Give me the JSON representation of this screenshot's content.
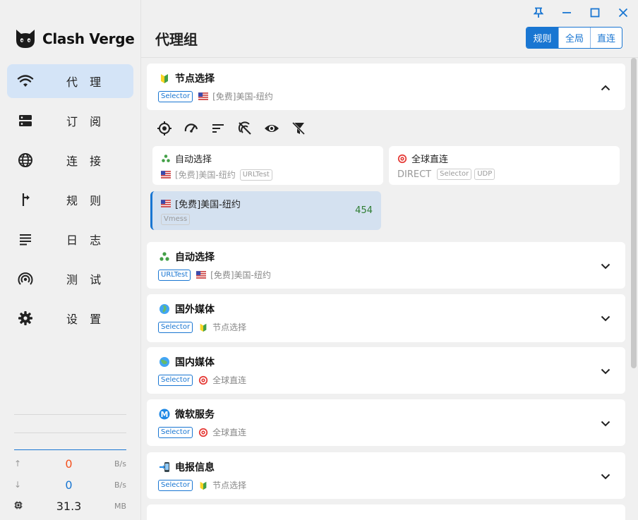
{
  "app": {
    "name": "Clash Verge"
  },
  "nav": [
    {
      "label": "代 理",
      "icon": "wifi-icon",
      "active": true
    },
    {
      "label": "订 阅",
      "icon": "dns-icon",
      "active": false
    },
    {
      "label": "连 接",
      "icon": "globe-icon",
      "active": false
    },
    {
      "label": "规 则",
      "icon": "fork-icon",
      "active": false
    },
    {
      "label": "日 志",
      "icon": "notes-icon",
      "active": false
    },
    {
      "label": "测 试",
      "icon": "radar-icon",
      "active": false
    },
    {
      "label": "设 置",
      "icon": "gear-icon",
      "active": false
    }
  ],
  "traffic": {
    "up": {
      "value": "0",
      "unit": "B/s",
      "color": "#f4511e"
    },
    "down": {
      "value": "0",
      "unit": "B/s",
      "color": "#1976d2"
    },
    "mem": {
      "value": "31.3",
      "unit": "MB"
    }
  },
  "header": {
    "title": "代理组",
    "modes": [
      {
        "label": "规则",
        "active": true
      },
      {
        "label": "全局",
        "active": false
      },
      {
        "label": "直连",
        "active": false
      }
    ]
  },
  "groups": [
    {
      "name": "节点选择",
      "tag": "Selector",
      "now": "[免费]美国-纽约",
      "icon": "beginner-icon",
      "now_icon": "us-flag-icon",
      "expanded": true
    },
    {
      "name": "自动选择",
      "tag": "URLTest",
      "now": "[免费]美国-纽约",
      "icon": "recycle-icon",
      "now_icon": "us-flag-icon",
      "expanded": false
    },
    {
      "name": "国外媒体",
      "tag": "Selector",
      "now": "节点选择",
      "icon": "globe-africa-icon",
      "now_icon": "beginner-icon",
      "expanded": false
    },
    {
      "name": "国内媒体",
      "tag": "Selector",
      "now": "全球直连",
      "icon": "globe-asia-icon",
      "now_icon": "target-icon",
      "expanded": false
    },
    {
      "name": "微软服务",
      "tag": "Selector",
      "now": "全球直连",
      "icon": "metro-m-icon",
      "now_icon": "target-icon",
      "expanded": false
    },
    {
      "name": "电报信息",
      "tag": "Selector",
      "now": "节点选择",
      "icon": "phone-arrow-icon",
      "now_icon": "beginner-icon",
      "expanded": false
    }
  ],
  "toolbar": [
    "locate-icon",
    "speed-icon",
    "sort-icon",
    "filter-delay-off-icon",
    "eye-icon",
    "filter-off-icon"
  ],
  "proxies": [
    {
      "name": "自动选择",
      "sub": "[免费]美国-纽约",
      "tags": [
        "URLTest"
      ],
      "icon": "recycle-icon",
      "sub_icon": "us-flag-icon",
      "delay": "",
      "selected": false
    },
    {
      "name": "全球直连",
      "sub": "DIRECT",
      "tags": [
        "Selector",
        "UDP"
      ],
      "icon": "target-icon",
      "sub_icon": "",
      "delay": "",
      "selected": false
    },
    {
      "name": "[免费]美国-纽约",
      "sub": "",
      "tags": [
        "Vmess"
      ],
      "icon": "us-flag-icon",
      "sub_icon": "",
      "delay": "454",
      "selected": true
    }
  ]
}
